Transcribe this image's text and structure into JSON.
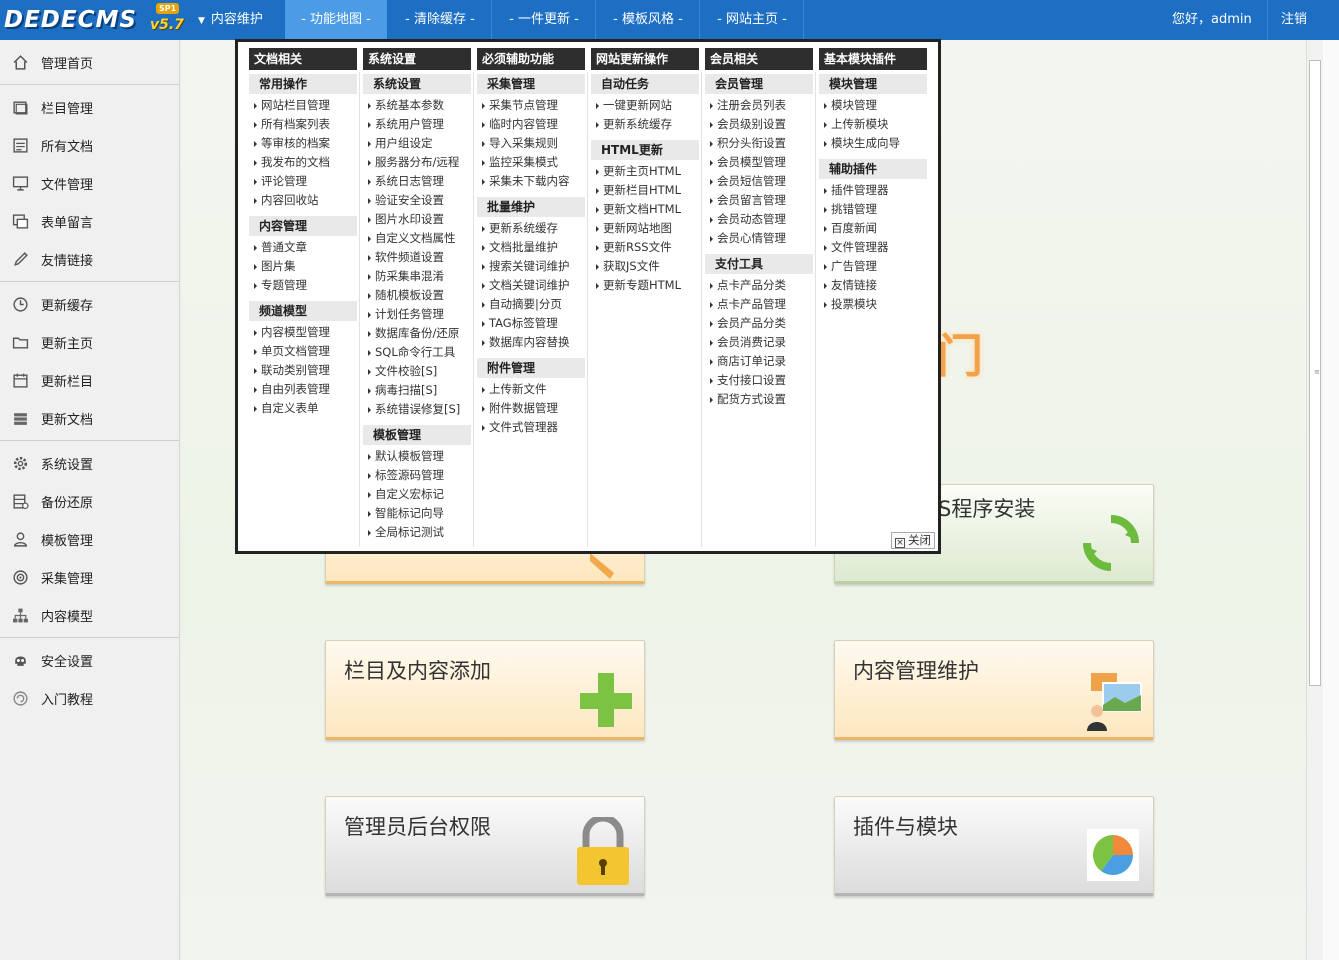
{
  "topbar": {
    "logo_brand": "DEDECMS",
    "logo_version": "v5.7",
    "logo_badge": "SP1",
    "nav": {
      "content": "内容维护",
      "funcmap": "- 功能地图 -",
      "cache": "- 清除缓存 -",
      "update": "- 一件更新 -",
      "tplstyle": "- 模板风格 -",
      "site": "- 网站主页 -"
    },
    "greeting": "您好，admin",
    "logout": "注销"
  },
  "sidebar": {
    "items": [
      {
        "label": "管理首页",
        "icon": "home-icon"
      },
      {
        "label": "栏目管理",
        "icon": "folders-icon"
      },
      {
        "label": "所有文档",
        "icon": "document-list-icon"
      },
      {
        "label": "文件管理",
        "icon": "monitor-icon"
      },
      {
        "label": "表单留言",
        "icon": "windows-icon"
      },
      {
        "label": "友情链接",
        "icon": "pen-icon"
      },
      {
        "label": "更新缓存",
        "icon": "clock-icon"
      },
      {
        "label": "更新主页",
        "icon": "folder-icon"
      },
      {
        "label": "更新栏目",
        "icon": "calendar-icon"
      },
      {
        "label": "更新文档",
        "icon": "stack-icon"
      },
      {
        "label": "系统设置",
        "icon": "gear-icon"
      },
      {
        "label": "备份还原",
        "icon": "database-icon"
      },
      {
        "label": "模板管理",
        "icon": "user-icon"
      },
      {
        "label": "采集管理",
        "icon": "target-icon"
      },
      {
        "label": "内容模型",
        "icon": "hierarchy-icon"
      },
      {
        "label": "安全设置",
        "icon": "skull-icon"
      },
      {
        "label": "入门教程",
        "icon": "swirl-icon"
      }
    ]
  },
  "funcmap": {
    "close": "关闭",
    "columns": [
      {
        "title": "文档相关",
        "groups": [
          {
            "title": "常用操作",
            "links": [
              "网站栏目管理",
              "所有档案列表",
              "等审核的档案",
              "我发布的文档",
              "评论管理",
              "内容回收站"
            ]
          },
          {
            "title": "内容管理",
            "links": [
              "普通文章",
              "图片集",
              "专题管理"
            ]
          },
          {
            "title": "频道模型",
            "links": [
              "内容模型管理",
              "单页文档管理",
              "联动类别管理",
              "自由列表管理",
              "自定义表单"
            ]
          }
        ]
      },
      {
        "title": "系统设置",
        "groups": [
          {
            "title": "系统设置",
            "links": [
              "系统基本参数",
              "系统用户管理",
              "用户组设定",
              "服务器分布/远程",
              "系统日志管理",
              "验证安全设置",
              "图片水印设置",
              "自定义文档属性",
              "软件频道设置",
              "防采集串混淆",
              "随机模板设置",
              "计划任务管理",
              "数据库备份/还原",
              "SQL命令行工具",
              "文件校验[S]",
              "病毒扫描[S]",
              "系统错误修复[S]"
            ]
          },
          {
            "title": "模板管理",
            "links": [
              "默认模板管理",
              "标签源码管理",
              "自定义宏标记",
              "智能标记向导",
              "全局标记测试"
            ]
          }
        ]
      },
      {
        "title": "必须辅助功能",
        "groups": [
          {
            "title": "采集管理",
            "links": [
              "采集节点管理",
              "临时内容管理",
              "导入采集规则",
              "监控采集模式",
              "采集未下载内容"
            ]
          },
          {
            "title": "批量维护",
            "links": [
              "更新系统缓存",
              "文档批量维护",
              "搜索关键词维护",
              "文档关键词维护",
              "自动摘要|分页",
              "TAG标签管理",
              "数据库内容替换"
            ]
          },
          {
            "title": "附件管理",
            "links": [
              "上传新文件",
              "附件数据管理",
              "文件式管理器"
            ]
          }
        ]
      },
      {
        "title": "网站更新操作",
        "groups": [
          {
            "title": "自动任务",
            "links": [
              "一键更新网站",
              "更新系统缓存"
            ]
          },
          {
            "title": "HTML更新",
            "links": [
              "更新主页HTML",
              "更新栏目HTML",
              "更新文档HTML",
              "更新网站地图",
              "更新RSS文件",
              "获取JS文件",
              "更新专题HTML"
            ]
          }
        ]
      },
      {
        "title": "会员相关",
        "groups": [
          {
            "title": "会员管理",
            "links": [
              "注册会员列表",
              "会员级别设置",
              "积分头衔设置",
              "会员模型管理",
              "会员短信管理",
              "会员留言管理",
              "会员动态管理",
              "会员心情管理"
            ]
          },
          {
            "title": "支付工具",
            "links": [
              "点卡产品分类",
              "点卡产品管理",
              "会员产品分类",
              "会员消费记录",
              "商店订单记录",
              "支付接口设置",
              "配货方式设置"
            ]
          }
        ]
      },
      {
        "title": "基本模块插件",
        "groups": [
          {
            "title": "模块管理",
            "links": [
              "模块管理",
              "上传新模块",
              "模块生成向导"
            ]
          },
          {
            "title": "辅助插件",
            "links": [
              "插件管理器",
              "挑错管理",
              "百度新闻",
              "文件管理器",
              "广告管理",
              "友情链接",
              "投票模块"
            ]
          }
        ]
      }
    ]
  },
  "tiles": {
    "partial_right_title": "S程序安装",
    "partial_glyph": "门",
    "content_add": "栏目及内容添加",
    "content_manage": "内容管理维护",
    "admin_rights": "管理员后台权限",
    "plugins_modules": "插件与模块"
  },
  "colors": {
    "topbar": "#1d6fc4",
    "topbar_active": "#4b9be6",
    "popup_header": "#2e2e2e"
  }
}
